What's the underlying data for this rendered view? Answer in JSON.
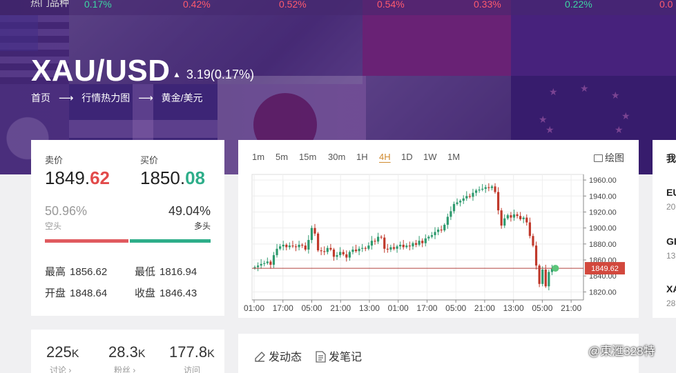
{
  "ticker": {
    "label": "热门品种",
    "items": [
      {
        "value": "0.17%",
        "color": "#3dd6a3"
      },
      {
        "value": "0.42%",
        "color": "#ff5a6e"
      },
      {
        "value": "0.52%",
        "color": "#ff5a6e"
      },
      {
        "value": "0.54%",
        "color": "#ff5a6e"
      },
      {
        "value": "0.33%",
        "color": "#ff5a6e"
      },
      {
        "value": "0.22%",
        "color": "#3dd6a3"
      },
      {
        "value": "0.0",
        "color": "#ff5a6e"
      }
    ]
  },
  "header": {
    "pair": "XAU/USD",
    "change": "3.19(0.17%)",
    "breadcrumb": [
      "首页",
      "行情热力图",
      "黄金/美元"
    ]
  },
  "quote": {
    "sell_label": "卖价",
    "sell_int": "1849.",
    "sell_dec": "62",
    "buy_label": "买价",
    "buy_int": "1850.",
    "buy_dec": "08",
    "short_pct": "50.96%",
    "short_label": "空头",
    "long_pct": "49.04%",
    "long_label": "多头",
    "short_ratio": 0.5096,
    "high_label": "最高",
    "high": "1856.62",
    "low_label": "最低",
    "low": "1816.94",
    "open_label": "开盘",
    "open": "1848.64",
    "close_label": "收盘",
    "close": "1846.43"
  },
  "chart": {
    "timeframes": [
      "1m",
      "5m",
      "15m",
      "30m",
      "1H",
      "4H",
      "1D",
      "1W",
      "1M"
    ],
    "active_timeframe": "4H",
    "draw_label": "绘图"
  },
  "chart_data": {
    "type": "candlestick",
    "x_ticks": [
      "01:00",
      "17:00",
      "05:00",
      "21:00",
      "13:00",
      "01:00",
      "17:00",
      "05:00",
      "21:00",
      "13:00",
      "05:00",
      "21:00"
    ],
    "y_ticks": [
      "1960.00",
      "1940.00",
      "1920.00",
      "1900.00",
      "1880.00",
      "1860.00",
      "1840.00",
      "1820.00"
    ],
    "ylim": [
      1810,
      1967
    ],
    "current_price": "1849.62",
    "closes": [
      1851,
      1853,
      1855,
      1856,
      1858,
      1854,
      1866,
      1874,
      1877,
      1879,
      1876,
      1878,
      1877,
      1876,
      1879,
      1878,
      1873,
      1885,
      1900,
      1893,
      1872,
      1871,
      1870,
      1875,
      1873,
      1864,
      1866,
      1870,
      1867,
      1863,
      1870,
      1873,
      1871,
      1874,
      1875,
      1874,
      1878,
      1884,
      1883,
      1889,
      1888,
      1874,
      1873,
      1876,
      1874,
      1877,
      1879,
      1876,
      1878,
      1877,
      1881,
      1879,
      1884,
      1881,
      1887,
      1889,
      1891,
      1895,
      1898,
      1897,
      1904,
      1914,
      1921,
      1930,
      1932,
      1934,
      1937,
      1940,
      1939,
      1944,
      1947,
      1948,
      1949,
      1951,
      1950,
      1952,
      1945,
      1922,
      1903,
      1912,
      1916,
      1913,
      1917,
      1915,
      1911,
      1913,
      1907,
      1890,
      1878,
      1853,
      1830,
      1848,
      1827,
      1845,
      1849
    ],
    "series_color_up": "#2e9a6e",
    "series_color_down": "#c0392b"
  },
  "news": {
    "items": [
      {
        "title": "我",
        "sub": ""
      },
      {
        "title": "EU",
        "sub": "20"
      },
      {
        "title": "GI",
        "sub": "13"
      },
      {
        "title": "XA",
        "sub": "28"
      }
    ]
  },
  "social": {
    "stats": [
      {
        "num": "225",
        "unit": "K",
        "label": "讨论 ›"
      },
      {
        "num": "28.3",
        "unit": "K",
        "label": "粉丝 ›"
      },
      {
        "num": "177.8",
        "unit": "K",
        "label": "访问"
      }
    ],
    "post_dynamic": "发动态",
    "post_note": "发笔记"
  },
  "watermark": "@東滙328特"
}
